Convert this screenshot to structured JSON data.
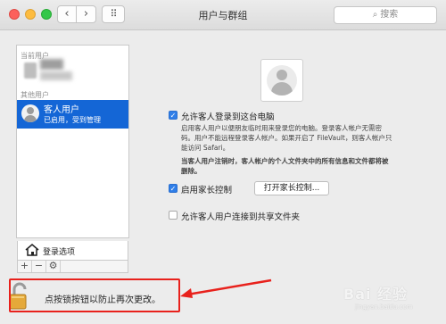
{
  "window": {
    "title": "用户与群组",
    "search_placeholder": "搜索"
  },
  "nav": {
    "back_glyph": "‹",
    "forward_glyph": "›",
    "grid_glyph": "⠿"
  },
  "sidebar": {
    "current_users_label": "当前用户",
    "other_users_label": "其他用户",
    "guest": {
      "name": "客人用户",
      "status": "已启用，受到管理"
    },
    "login_options_label": "登录选项",
    "tools": [
      "+",
      "−",
      "⚙"
    ]
  },
  "main": {
    "allow_guest_login": {
      "label": "允许客人登录到这台电脑",
      "checked": true
    },
    "allow_guest_desc_1": "启用客人用户以便朋友临时用来登录您的电脑。登录客人帐户无需密",
    "allow_guest_desc_2": "码。用户不能远程登录客人帐户。如果开启了 FileVault，则客人帐户只",
    "allow_guest_desc_3": "能访问 Safari。",
    "logout_note_1": "当客人用户注销时，客人帐户的个人文件夹中的所有信息和文件都将被",
    "logout_note_2": "删除。",
    "parental_controls": {
      "label": "启用家长控制",
      "checked": true,
      "button_label": "打开家长控制..."
    },
    "shared_folders": {
      "label": "允许客人用户连接到共享文件夹",
      "checked": false
    }
  },
  "lock": {
    "text": "点按锁按钮以防止再次更改。"
  },
  "annotation": {
    "color": "#e8211c"
  },
  "watermark": {
    "text": "Bai 经验",
    "sub": "jingyan.baidu.com"
  },
  "colors": {
    "selection": "#1466d6",
    "checkbox": "#2f7ee8"
  }
}
